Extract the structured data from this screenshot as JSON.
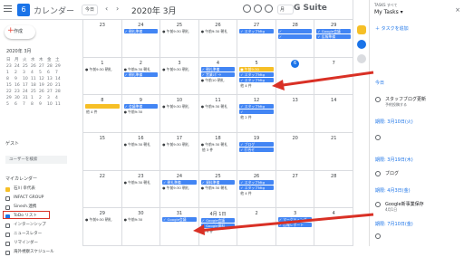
{
  "header": {
    "app_title": "カレンダー",
    "logo_day": "6",
    "today": "今日",
    "month": "2020年 3月",
    "view": "月",
    "brand": "G Suite"
  },
  "sidebar": {
    "create": "作成",
    "mini_month": "2020年 3月",
    "mini_days": [
      "日",
      "月",
      "火",
      "水",
      "木",
      "金",
      "土"
    ],
    "mini_dates": [
      "23",
      "24",
      "25",
      "26",
      "27",
      "28",
      "29",
      "1",
      "2",
      "3",
      "4",
      "5",
      "6",
      "7",
      "8",
      "9",
      "10",
      "11",
      "12",
      "13",
      "14",
      "15",
      "16",
      "17",
      "18",
      "19",
      "20",
      "21",
      "22",
      "23",
      "24",
      "25",
      "26",
      "27",
      "28",
      "29",
      "30",
      "31",
      "1",
      "2",
      "3",
      "4",
      "5",
      "6",
      "7",
      "8",
      "9",
      "10",
      "11"
    ],
    "guests_label": "ゲスト",
    "search_placeholder": "ユーザーを検索",
    "my_calendars_label": "マイカレンダー",
    "calendars": [
      {
        "label": "石川 幸代表",
        "color": "#f6bf26"
      },
      {
        "label": "INFACT GROUP",
        "color": "#ffffff"
      },
      {
        "label": "Sinesh.連携",
        "color": "#ffffff"
      },
      {
        "label": "ToDo リスト",
        "color": "#1a73e8"
      },
      {
        "label": "インターンシップ",
        "color": "#ffffff"
      },
      {
        "label": "ニュースレター",
        "color": "#ffffff"
      },
      {
        "label": "リマインダー",
        "color": "#ffffff"
      },
      {
        "label": "海外視察スケジュール",
        "color": "#ffffff"
      }
    ]
  },
  "calendar": {
    "weeks": [
      {
        "dates": [
          "23",
          "24",
          "25",
          "26",
          "27",
          "28",
          "29"
        ]
      },
      {
        "dates": [
          "1",
          "2",
          "3",
          "4",
          "5",
          "6",
          "7"
        ]
      },
      {
        "dates": [
          "8",
          "9",
          "10",
          "11",
          "12",
          "13",
          "14"
        ]
      },
      {
        "dates": [
          "15",
          "16",
          "17",
          "18",
          "19",
          "20",
          "21"
        ]
      },
      {
        "dates": [
          "22",
          "23",
          "24",
          "25",
          "26",
          "27",
          "28"
        ]
      },
      {
        "dates": [
          "29",
          "30",
          "31",
          "4月 1日",
          "2",
          "3",
          "4"
        ]
      }
    ],
    "week0": {
      "d1": "✓ 朝礼準備",
      "d2": "● 午前9:30 朝礼",
      "d3": "● 午前9:30 朝礼",
      "d4": "✓ スタッフMtg",
      "d5": "✓",
      "d6": "✓ Google会議",
      "d7b": "● 午前9:30 朝礼",
      "d5b": "✓",
      "d6b": "✓ 広報準備"
    },
    "week1": {
      "d1": "● 午前9:30 朝礼",
      "d1b": "✓ 朝礼準備",
      "d2": "● 午前9:30 朝礼",
      "d3": "✓ 朝礼準備",
      "d3b": "✓ 営業ﾚﾎﾟｰﾄ",
      "d3c": "● 午前10 朝礼",
      "d4": "● 午前9:30",
      "d4b": "✓ スタッフMtg",
      "d4c": "✓ スタッフMtg",
      "d0": "● 午前9:30 朝礼",
      "more": "他 4 件"
    },
    "week2": {
      "d1": "✓ 会議準備",
      "d1b": "● 午前9:30",
      "d2": "● 午前9:30 朝礼",
      "d3": "● 午前9:30 朝礼",
      "d4": "✓ スタッフMtg",
      "d4b": "✓",
      "more": "他 4 件",
      "more2": "他 2 件"
    },
    "week3": {
      "d4": "✓ ブログ",
      "d4b": "✓ 打合せ",
      "d1": "● 午前9:30 朝礼",
      "d2": "● 午前9:30 朝礼",
      "d3": "● 午前9:30 朝礼",
      "more": "他 3 件"
    },
    "week4": {
      "d1": "● 午前9:30 朝礼",
      "d2": "✓ 朝礼準備",
      "d3": "✓ 資料準備",
      "d4": "✓ スタッフMtg",
      "d2b": "● 午前9:30 朝礼",
      "d3b": "● 午前9:30 朝礼",
      "d4b": "✓ スタッフMtg",
      "more": "他 4 件"
    },
    "week5": {
      "d2": "✓ Google会議",
      "d3": "✓ Google会議",
      "d1": "● 午前9:30",
      "d5": "✓ マーケティング",
      "d5b": "✓ 広報レポート",
      "d3b": "✓ Google資料",
      "d0": "● 午前9:30 朝礼",
      "more": "他 3 件"
    }
  },
  "tasks": {
    "header_small": "TASKS すべて",
    "title": "My Tasks ▾",
    "add": "＋ タスクを追加",
    "today_label": "今日",
    "item1": "スタッフブログ更新",
    "item1_sub": "予約投稿する",
    "sec2": "期限: 3月10日(火)",
    "sec3": "期限: 3月19日(木)",
    "item3": "ブログ",
    "sec4": "期限: 4月3日(金)",
    "item4": "Google新事業保存",
    "item4_sub": "4月1日",
    "sec5": "期限: 7月10日(金)"
  },
  "colors": {
    "accent": "#1a73e8",
    "event": "#4285f4",
    "today": "#1a73e8",
    "arrow": "#d93025"
  }
}
